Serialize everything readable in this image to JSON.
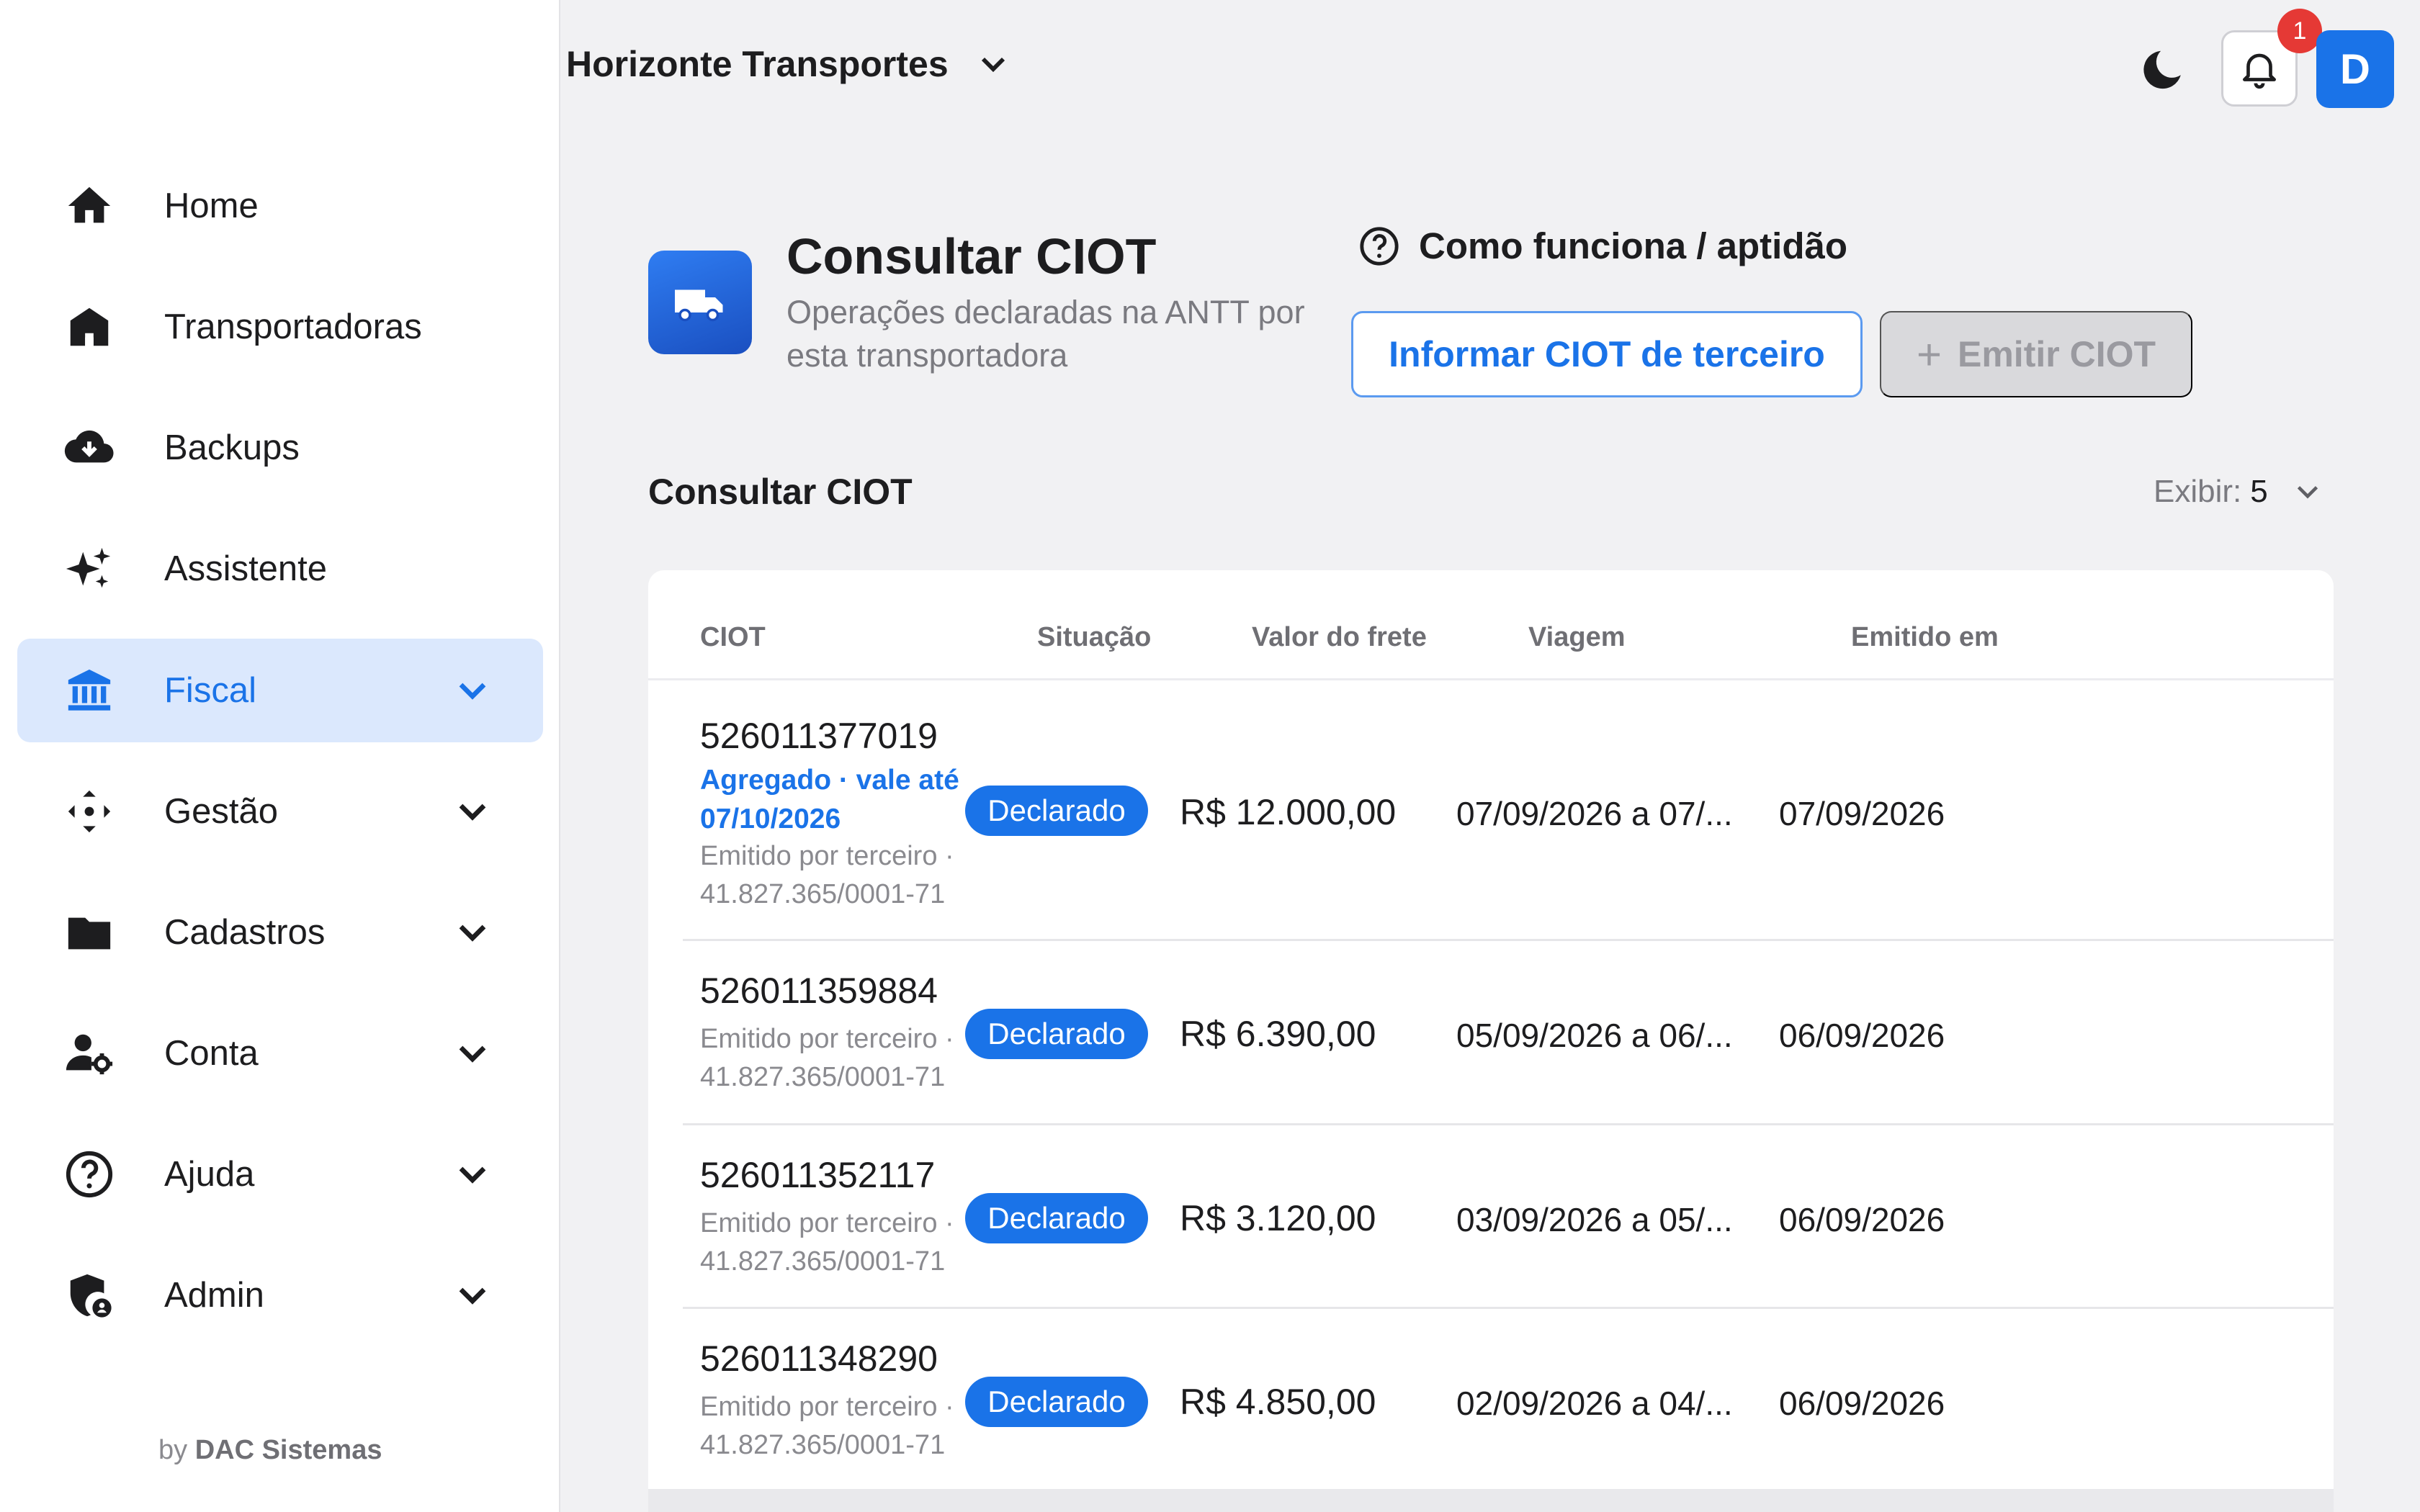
{
  "sidebar": {
    "items": [
      {
        "label": "Home",
        "icon": "home-icon"
      },
      {
        "label": "Transportadoras",
        "icon": "building-icon"
      },
      {
        "label": "Backups",
        "icon": "cloud-download-icon"
      },
      {
        "label": "Assistente",
        "icon": "sparkles-icon"
      },
      {
        "label": "Fiscal",
        "icon": "bank-icon",
        "active": true
      },
      {
        "label": "Gestão",
        "icon": "move-icon"
      },
      {
        "label": "Cadastros",
        "icon": "folder-icon"
      },
      {
        "label": "Conta",
        "icon": "user-settings-icon"
      },
      {
        "label": "Ajuda",
        "icon": "help-icon"
      },
      {
        "label": "Admin",
        "icon": "admin-shield-icon"
      }
    ],
    "footer_prefix": "by",
    "footer_brand": "DAC Sistemas"
  },
  "topbar": {
    "company": "Horizonte Transportes",
    "notifications_count": "1",
    "avatar_initial": "D"
  },
  "page": {
    "title": "Consultar CIOT",
    "subtitle": "Operações declaradas na ANTT por esta transportadora",
    "help_label": "Como funciona / aptidão",
    "primary_action": "Informar CIOT de terceiro",
    "disabled_action": "Emitir CIOT",
    "disabled_action_icon": "+"
  },
  "section": {
    "title": "Consultar CIOT",
    "page_size_label": "Exibir:",
    "page_size_value": "5"
  },
  "table": {
    "columns": [
      "CIOT",
      "Situação",
      "Valor do frete",
      "Viagem",
      "Emitido em"
    ],
    "rows": [
      {
        "ciot": "526011377019",
        "aggregated": "Agregado · vale até 07/10/2026",
        "issuer": "Emitido por terceiro · 41.827.365/0001-71",
        "status": "Declarado",
        "value": "R$ 12.000,00",
        "trip": "07/09/2026 a 07/...",
        "issued": "07/09/2026"
      },
      {
        "ciot": "526011359884",
        "issuer": "Emitido por terceiro · 41.827.365/0001-71",
        "status": "Declarado",
        "value": "R$ 6.390,00",
        "trip": "05/09/2026 a 06/...",
        "issued": "06/09/2026"
      },
      {
        "ciot": "526011352117",
        "issuer": "Emitido por terceiro · 41.827.365/0001-71",
        "status": "Declarado",
        "value": "R$ 3.120,00",
        "trip": "03/09/2026 a 05/...",
        "issued": "06/09/2026"
      },
      {
        "ciot": "526011348290",
        "issuer": "Emitido por terceiro · 41.827.365/0001-71",
        "status": "Declarado",
        "value": "R$ 4.850,00",
        "trip": "02/09/2026 a 04/...",
        "issued": "06/09/2026"
      }
    ]
  },
  "colors": {
    "accent": "#1a73e8",
    "active_nav_bg": "#dbe8fd",
    "badge_red": "#e53935"
  }
}
